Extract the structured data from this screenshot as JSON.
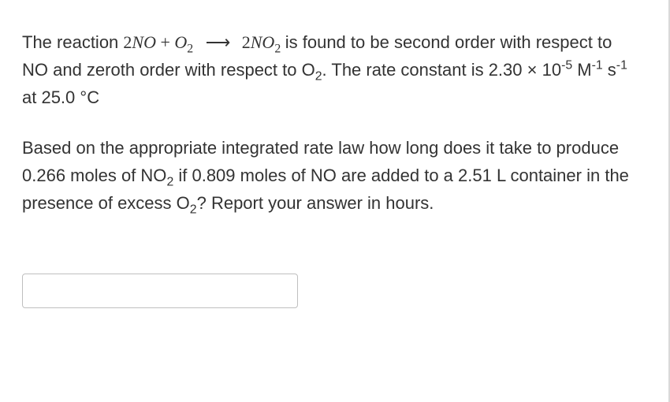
{
  "p1": {
    "lead": "The reaction ",
    "eq_lhs_coef1": "2",
    "eq_lhs_sp1": "NO",
    "eq_plus": " + ",
    "eq_lhs_sp2": "O",
    "eq_lhs_sp2_sub": "2",
    "arrow": "⟶",
    "eq_rhs_coef": "2",
    "eq_rhs_sp": "NO",
    "eq_rhs_sub": "2",
    "after_eq": "  is found to be second order with respect to NO and zeroth order with respect to O",
    "o2_sub": "2",
    "after_o2": ". The rate constant is 2.30 × 10",
    "k_exp": "-5",
    "k_unit1": " M",
    "k_unit1_sup": "-1",
    "k_unit2": " s",
    "k_unit2_sup": "-1",
    "k_tail": " at 25.0 °C"
  },
  "p2": {
    "a": "Based on the appropriate integrated rate law how long does it take to produce 0.266 moles of NO",
    "no2_sub": "2",
    "b": " if 0.809 moles of NO are added to a 2.51 L container in the presence of excess O",
    "o2_sub": "2",
    "c": "? Report your answer in hours."
  },
  "input": {
    "value": "",
    "placeholder": ""
  }
}
